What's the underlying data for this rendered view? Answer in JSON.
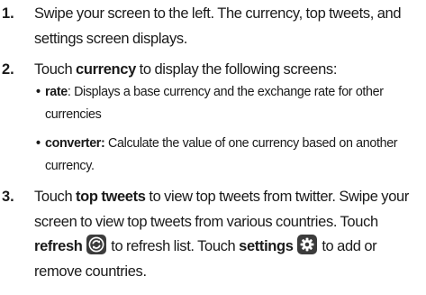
{
  "steps": [
    {
      "number": "1.",
      "text": "Swipe your screen to the left. The currency, top tweets, and settings screen displays."
    },
    {
      "number": "2.",
      "pre": "Touch ",
      "bold": "currency",
      "post": " to display the following screens:",
      "bullets": [
        {
          "marker": "•",
          "term": "rate",
          "text": ": Displays a base currency and the exchange rate for other currencies"
        },
        {
          "marker": "•",
          "term": "converter:",
          "text": " Calculate the value of one currency based on another currency."
        }
      ]
    },
    {
      "number": "3.",
      "pre": "Touch ",
      "bold1": "top tweets",
      "mid1": " to view top tweets from twitter. Swipe your screen to view top tweets from various countries. Touch ",
      "bold2": "refresh",
      "mid2": " to refresh list. Touch ",
      "bold3": "settings",
      "post": " to add or remove countries.",
      "icons": [
        "refresh-icon",
        "settings-icon"
      ]
    }
  ]
}
